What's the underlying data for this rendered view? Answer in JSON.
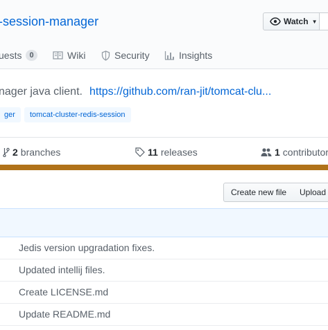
{
  "header": {
    "repo_name": "-session-manager",
    "watch_label": "Watch"
  },
  "tabs": [
    {
      "label": "uests",
      "count": "0",
      "icon": "pull-request-icon"
    },
    {
      "label": "Wiki",
      "icon": "book-icon"
    },
    {
      "label": "Security",
      "icon": "shield-icon"
    },
    {
      "label": "Insights",
      "icon": "graph-icon"
    }
  ],
  "description": {
    "text": "nager java client.",
    "link": "https://github.com/ran-jit/tomcat-clu..."
  },
  "topics": [
    "ger",
    "tomcat-cluster-redis-session"
  ],
  "stats": {
    "branches_count": "2",
    "branches_label": "branches",
    "releases_count": "11",
    "releases_label": "releases",
    "contributors_count": "1",
    "contributors_label": "contributor"
  },
  "language_color": "#b07219",
  "buttons": {
    "create_new_file": "Create new file",
    "upload": "Upload"
  },
  "files": [
    {
      "message": "Jedis version upgradation fixes."
    },
    {
      "message": "Updated intellij files."
    },
    {
      "message": "Create LICENSE.md"
    },
    {
      "message": "Update README.md"
    }
  ]
}
